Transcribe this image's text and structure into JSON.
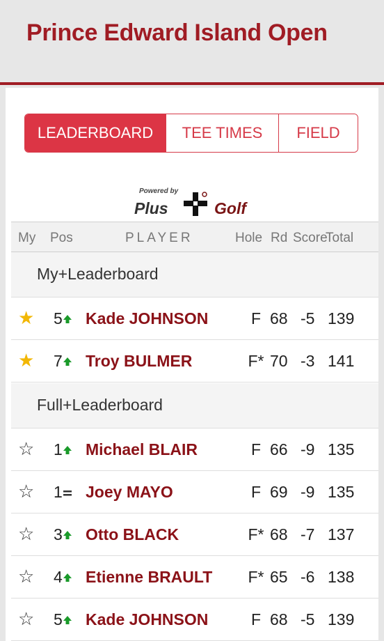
{
  "title": "Prince Edward Island Open",
  "tabs": [
    {
      "label": "LEADERBOARD",
      "active": true
    },
    {
      "label": "TEE TIMES",
      "active": false
    },
    {
      "label": "FIELD",
      "active": false
    }
  ],
  "powered": {
    "by": "Powered by",
    "plus": "Plus",
    "golf": "Golf"
  },
  "columns": {
    "my": "My",
    "pos": "Pos",
    "player": "PLAYER",
    "hole": "Hole",
    "rd": "Rd",
    "score": "Score",
    "total": "Total"
  },
  "sections": {
    "my": "My+Leaderboard",
    "full": "Full+Leaderboard"
  },
  "my_rows": [
    {
      "favorite": true,
      "pos": "5",
      "move": "up",
      "name": "Kade JOHNSON",
      "hole": "F",
      "rd": "68",
      "score": "-5",
      "total": "139"
    },
    {
      "favorite": true,
      "pos": "7",
      "move": "up",
      "name": "Troy BULMER",
      "hole": "F*",
      "rd": "70",
      "score": "-3",
      "total": "141"
    }
  ],
  "full_rows": [
    {
      "favorite": false,
      "pos": "1",
      "move": "up",
      "name": "Michael BLAIR",
      "hole": "F",
      "rd": "66",
      "score": "-9",
      "total": "135"
    },
    {
      "favorite": false,
      "pos": "1",
      "move": "same",
      "name": "Joey MAYO",
      "hole": "F",
      "rd": "69",
      "score": "-9",
      "total": "135"
    },
    {
      "favorite": false,
      "pos": "3",
      "move": "up",
      "name": "Otto BLACK",
      "hole": "F*",
      "rd": "68",
      "score": "-7",
      "total": "137"
    },
    {
      "favorite": false,
      "pos": "4",
      "move": "up",
      "name": "Etienne BRAULT",
      "hole": "F*",
      "rd": "65",
      "score": "-6",
      "total": "138"
    },
    {
      "favorite": false,
      "pos": "5",
      "move": "up",
      "name": "Kade JOHNSON",
      "hole": "F",
      "rd": "68",
      "score": "-5",
      "total": "139"
    }
  ],
  "colors": {
    "brand": "#a01c24",
    "tab_active": "#dc3545",
    "star_on": "#f2b705",
    "arrow_up": "#1a9a2a"
  },
  "icons": {
    "favorite_on": "star-filled-icon",
    "favorite_off": "star-outline-icon",
    "up": "arrow-up-icon",
    "same": "equals-icon"
  }
}
